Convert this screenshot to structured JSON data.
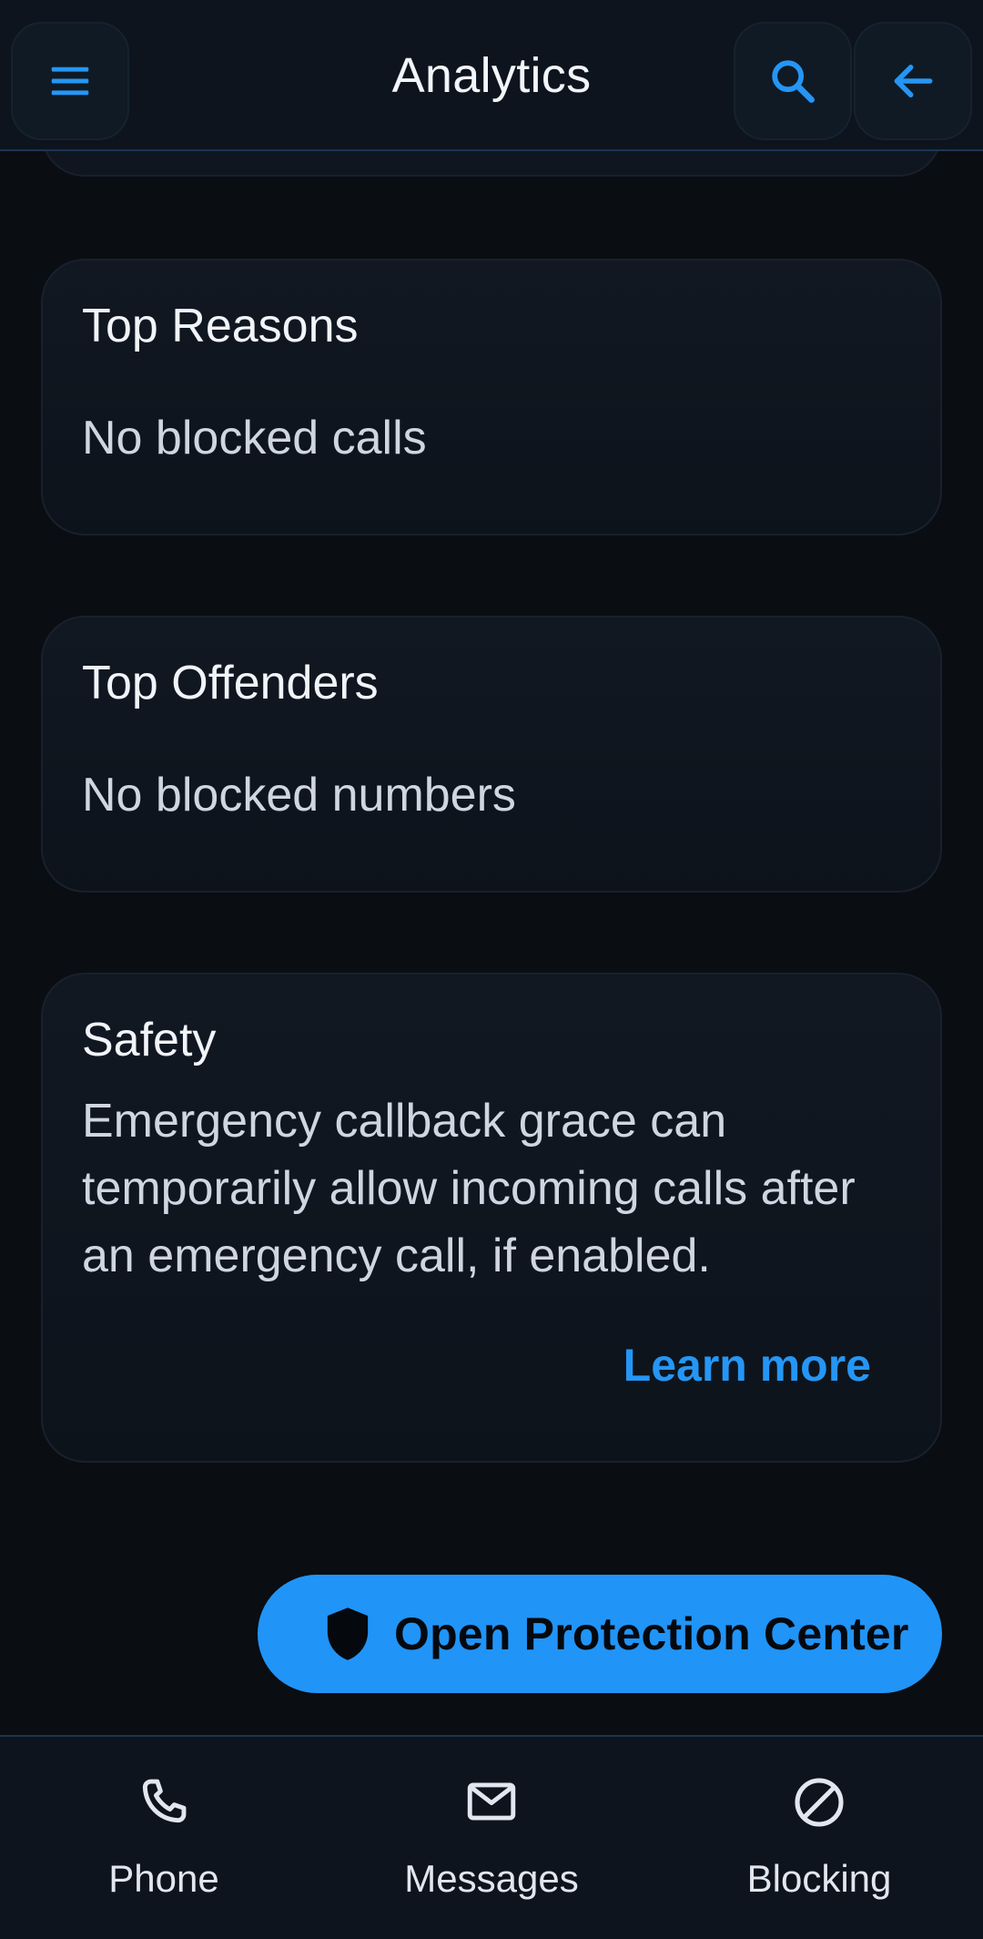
{
  "app_bar": {
    "title": "Analytics",
    "menu_icon": "menu-icon",
    "search_icon": "search-icon",
    "back_icon": "arrow-back-icon"
  },
  "cards": {
    "top_reasons": {
      "title": "Top Reasons",
      "body": "No blocked calls"
    },
    "top_offenders": {
      "title": "Top Offenders",
      "body": "No blocked numbers"
    },
    "safety": {
      "title": "Safety",
      "body": "Emergency callback grace can temporarily allow incoming calls after an emergency call, if enabled.",
      "link_label": "Learn more"
    }
  },
  "fab": {
    "label": "Open Protection Center",
    "icon": "shield-icon"
  },
  "bottom_nav": {
    "items": [
      {
        "label": "Phone",
        "icon": "phone-icon"
      },
      {
        "label": "Messages",
        "icon": "mail-icon"
      },
      {
        "label": "Blocking",
        "icon": "block-icon"
      }
    ]
  },
  "colors": {
    "accent": "#2194f7",
    "background": "#0a0d12",
    "surface": "#10161f",
    "text_primary": "#f1f4f9",
    "text_secondary": "#cfd6e2"
  }
}
